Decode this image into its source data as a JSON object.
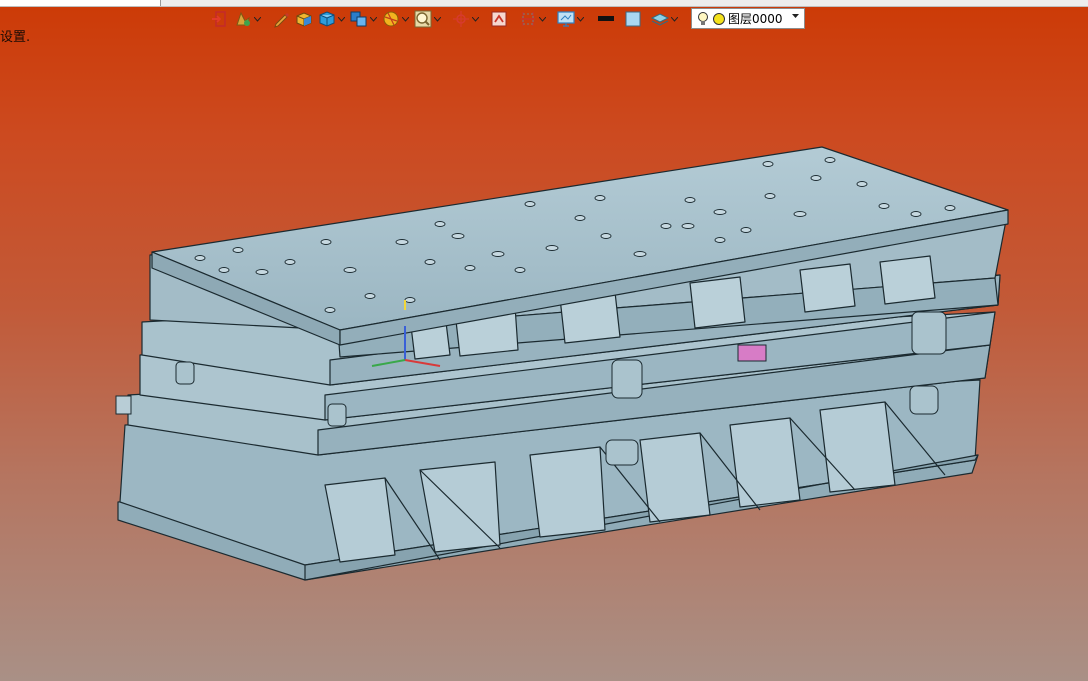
{
  "window": {
    "hint_text": "设置."
  },
  "toolbar": {
    "items": [
      {
        "name": "exit-sketch",
        "icon": "exit-arrow-icon",
        "color": "#e23b2b",
        "dropdown": false
      },
      {
        "name": "feature-tools",
        "icon": "feature-icon",
        "color": "#d9a43a",
        "dropdown": true
      },
      {
        "name": "pencil",
        "icon": "pencil-icon",
        "color": "#e8a33a",
        "dropdown": false
      },
      {
        "name": "solid-box",
        "icon": "box-icon",
        "color": "#3a88d8",
        "dropdown": false
      },
      {
        "name": "cube-shading",
        "icon": "cube-icon",
        "color": "#2d9cdb",
        "dropdown": true
      },
      {
        "name": "assembly",
        "icon": "assembly-icon",
        "color": "#2b7dc9",
        "dropdown": true
      },
      {
        "name": "render",
        "icon": "render-sphere-icon",
        "color": "#f2b21f",
        "dropdown": true
      },
      {
        "name": "zoom",
        "icon": "zoom-icon",
        "color": "#d7a73c",
        "dropdown": true
      },
      {
        "name": "origin",
        "icon": "crosshair-icon",
        "color": "#d63b2e",
        "dropdown": true
      },
      {
        "name": "snap",
        "icon": "magnet-icon",
        "color": "#c9352a",
        "dropdown": false
      },
      {
        "name": "section",
        "icon": "section-icon",
        "color": "#c9352a",
        "dropdown": true
      },
      {
        "name": "display",
        "icon": "monitor-icon",
        "color": "#2f7fc2",
        "dropdown": true
      },
      {
        "name": "line-color",
        "icon": "black-bar-icon",
        "color": "#111111",
        "dropdown": false
      },
      {
        "name": "face-color",
        "icon": "face-color-icon",
        "color": "#a9d7f2",
        "dropdown": false
      },
      {
        "name": "layers",
        "icon": "layers-icon",
        "color": "#6cb2c9",
        "dropdown": true
      }
    ]
  },
  "layer": {
    "name": "图层0000",
    "bulb_color": "#f4d23a",
    "dot_color": "#f4e21c"
  },
  "viewport": {
    "model_color": "#9fb9c4",
    "edge_color": "#1b2a30",
    "highlight_color": "#d77cc6"
  }
}
